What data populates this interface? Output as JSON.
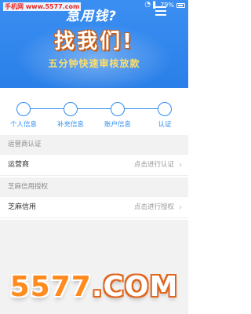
{
  "watermark": "手机网 www.5577.com",
  "status_bar": {
    "wifi_icon": "wifi-icon",
    "signal_icon": "signal-icon",
    "battery": "79%"
  },
  "header": {
    "top_text": "急用钱?",
    "main_title": "找我们!",
    "subtitle": "五分钟快速审核放款",
    "bg_color": "#2a7fe8",
    "menu_icon": "menu-icon"
  },
  "steps": [
    {
      "label": "个人信息"
    },
    {
      "label": "补充信息"
    },
    {
      "label": "账户信息"
    },
    {
      "label": "认证"
    }
  ],
  "sections": [
    {
      "title": "运营商认证",
      "row": {
        "name": "运营商",
        "action": "点击进行认证"
      }
    },
    {
      "title": "芝麻信用授权",
      "row": {
        "name": "芝麻信用",
        "action": "点击进行授权"
      }
    }
  ],
  "brand": {
    "num": "5577",
    "suffix": ".COM"
  },
  "colors": {
    "accent": "#2f8ef0",
    "brand_orange": "#e0651d"
  }
}
